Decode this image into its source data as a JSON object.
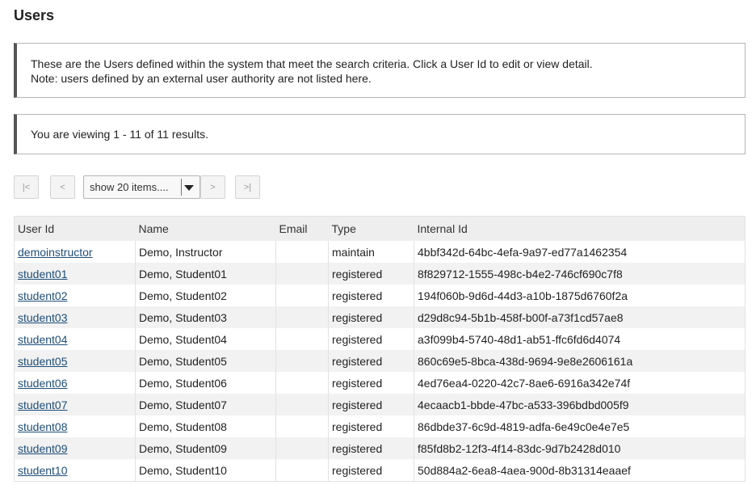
{
  "page": {
    "title": "Users"
  },
  "instructions": {
    "line1": "These are the Users defined within the system that meet the search criteria. Click a User Id to edit or view detail.",
    "line2": "Note: users defined by an external user authority are not listed here."
  },
  "viewing": {
    "text": "You are viewing 1 - 11 of 11 results."
  },
  "pager": {
    "first_label": "|<",
    "prev_label": "<",
    "page_size_selected": "show 20 items....",
    "next_label": ">",
    "last_label": ">|"
  },
  "table": {
    "headers": {
      "user_id": "User Id",
      "name": "Name",
      "email": "Email",
      "type": "Type",
      "internal_id": "Internal Id"
    },
    "rows": [
      {
        "user_id": "demoinstructor",
        "name": "Demo, Instructor",
        "email": "",
        "type": "maintain",
        "internal_id": "4bbf342d-64bc-4efa-9a97-ed77a1462354"
      },
      {
        "user_id": "student01",
        "name": "Demo, Student01",
        "email": "",
        "type": "registered",
        "internal_id": "8f829712-1555-498c-b4e2-746cf690c7f8"
      },
      {
        "user_id": "student02",
        "name": "Demo, Student02",
        "email": "",
        "type": "registered",
        "internal_id": "194f060b-9d6d-44d3-a10b-1875d6760f2a"
      },
      {
        "user_id": "student03",
        "name": "Demo, Student03",
        "email": "",
        "type": "registered",
        "internal_id": "d29d8c94-5b1b-458f-b00f-a73f1cd57ae8"
      },
      {
        "user_id": "student04",
        "name": "Demo, Student04",
        "email": "",
        "type": "registered",
        "internal_id": "a3f099b4-5740-48d1-ab51-ffc6fd6d4074"
      },
      {
        "user_id": "student05",
        "name": "Demo, Student05",
        "email": "",
        "type": "registered",
        "internal_id": "860c69e5-8bca-438d-9694-9e8e2606161a"
      },
      {
        "user_id": "student06",
        "name": "Demo, Student06",
        "email": "",
        "type": "registered",
        "internal_id": "4ed76ea4-0220-42c7-8ae6-6916a342e74f"
      },
      {
        "user_id": "student07",
        "name": "Demo, Student07",
        "email": "",
        "type": "registered",
        "internal_id": "4ecaacb1-bbde-47bc-a533-396bdbd005f9"
      },
      {
        "user_id": "student08",
        "name": "Demo, Student08",
        "email": "",
        "type": "registered",
        "internal_id": "86dbde37-6c9d-4819-adfa-6e49c0e4e7e5"
      },
      {
        "user_id": "student09",
        "name": "Demo, Student09",
        "email": "",
        "type": "registered",
        "internal_id": "f85fd8b2-12f3-4f14-83dc-9d7b2428d010"
      },
      {
        "user_id": "student10",
        "name": "Demo, Student10",
        "email": "",
        "type": "registered",
        "internal_id": "50d884a2-6ea8-4aea-900d-8b31314eaaef"
      }
    ]
  }
}
